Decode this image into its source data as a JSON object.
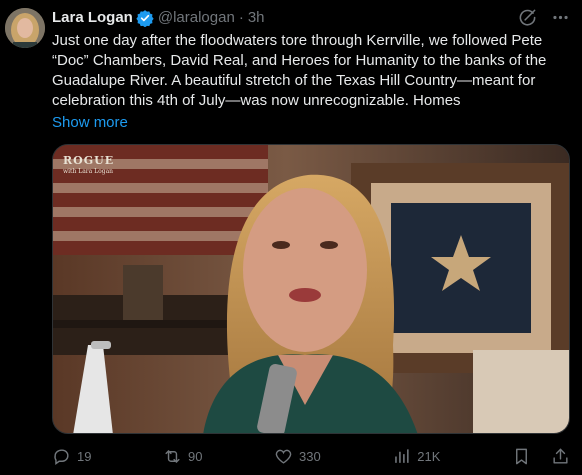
{
  "author": {
    "name": "Lara Logan",
    "handle": "@laralogan",
    "separator": "·",
    "time": "3h",
    "verified": true
  },
  "tweet": {
    "text_lines": [
      "Just one day after the floodwaters tore through Kerrville, we followed Pete",
      "“Doc” Chambers, David Real, and Heroes for Humanity to the banks of the",
      "Guadalupe River. A beautiful stretch of the Texas Hill Country—meant for",
      "celebration this 4th of July—was now unrecognizable. Homes"
    ],
    "show_more": "Show more"
  },
  "media": {
    "type": "video-still",
    "watermark": "ROGUE",
    "watermark_sub": "with Lara Logan"
  },
  "metrics": {
    "replies": "19",
    "reposts": "90",
    "likes": "330",
    "views": "21K"
  },
  "icons": {
    "verified": "verified-badge-icon",
    "grok": "grok-icon",
    "more": "more-icon",
    "reply": "reply-icon",
    "repost": "repost-icon",
    "like": "like-icon",
    "views": "views-icon",
    "bookmark": "bookmark-icon",
    "share": "share-icon"
  },
  "colors": {
    "background": "#000000",
    "text": "#e7e9ea",
    "muted": "#71767b",
    "link": "#1d9bf0",
    "verified": "#1d9bf0"
  }
}
